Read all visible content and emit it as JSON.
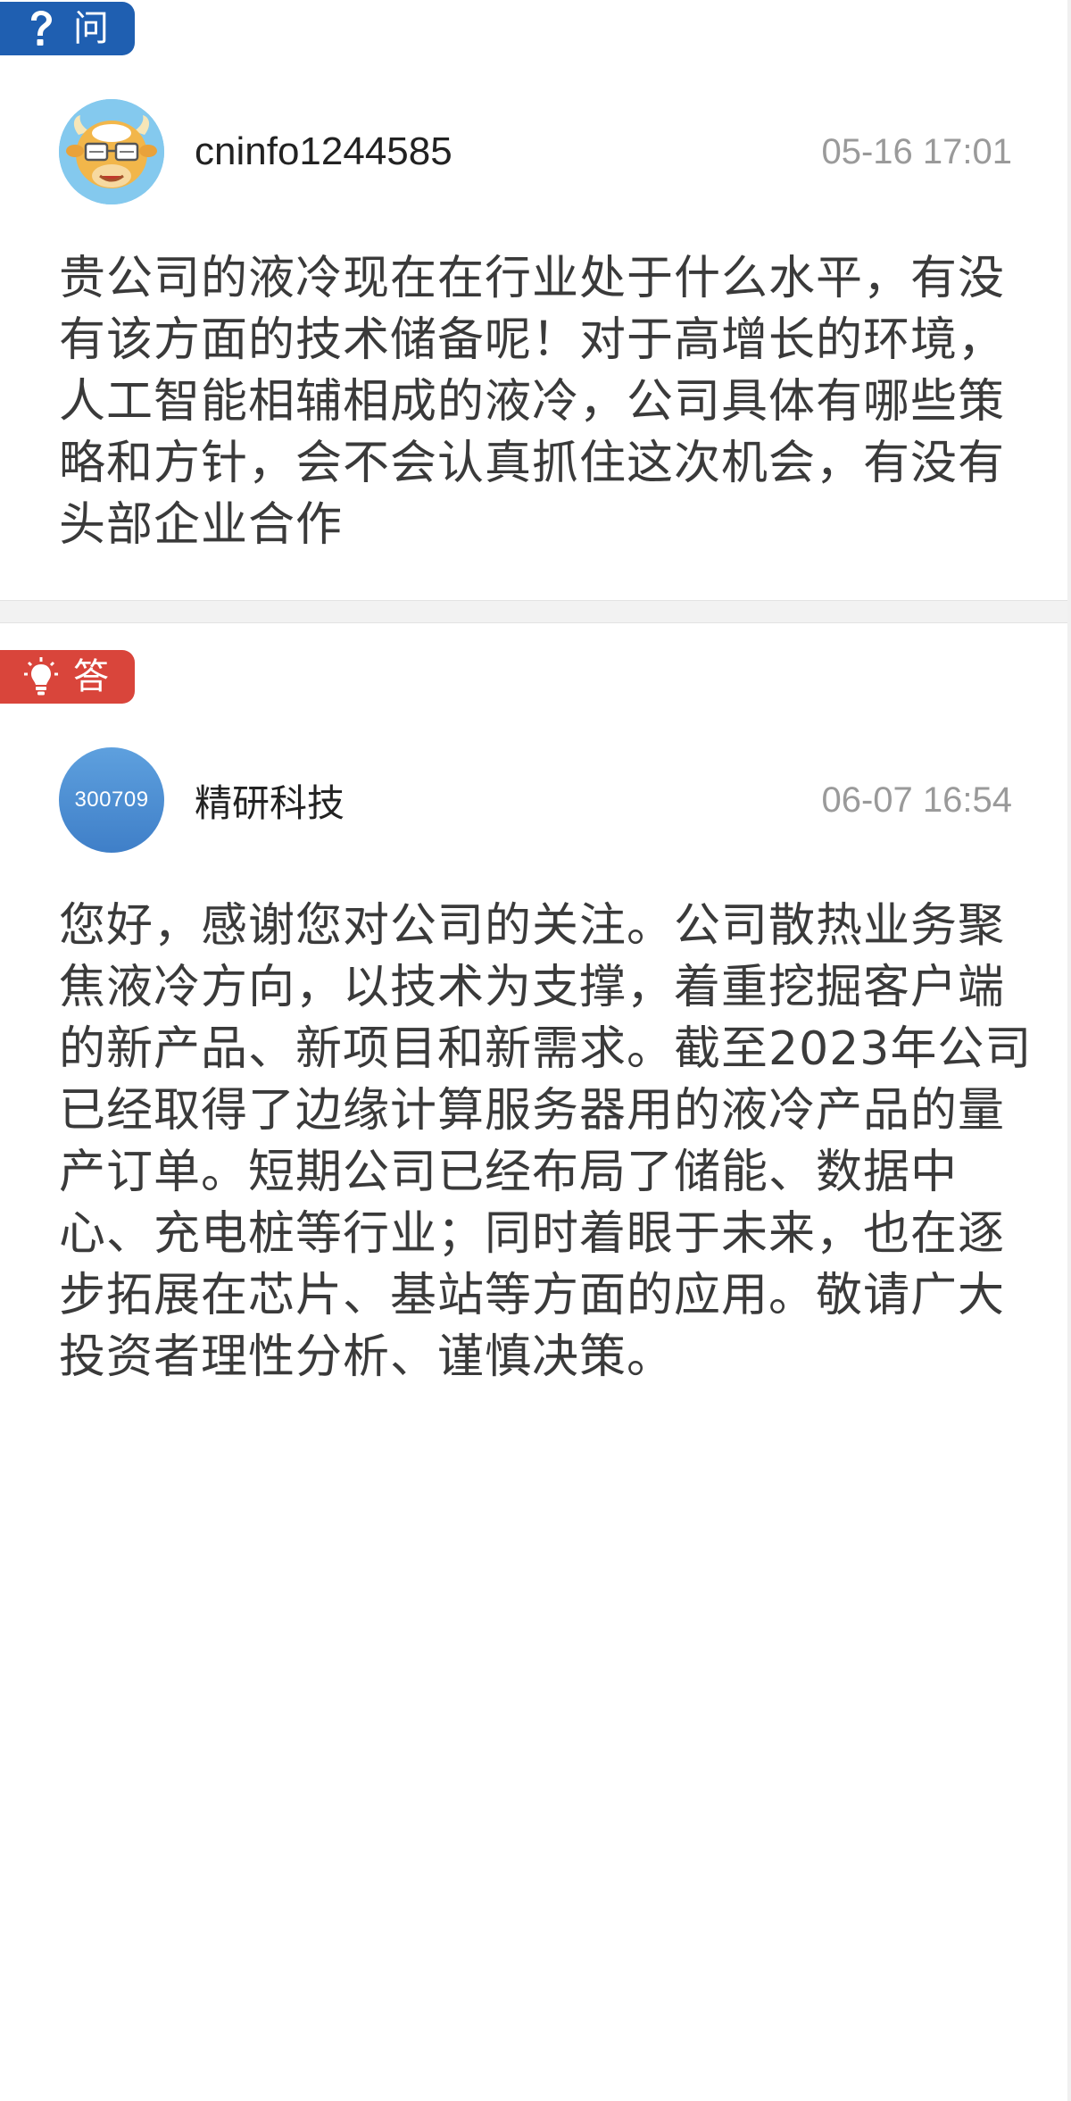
{
  "question": {
    "tag_label": "问",
    "tag_icon": "question-mark-icon",
    "tag_color": "#1f5fb1",
    "user": {
      "name": "cninfo1244585",
      "avatar": "cartoon-cow-avatar"
    },
    "time": "05-16 17:01",
    "lines": [
      "贵公司的液冷现在在行业处于什么水平，有没",
      "有该方面的技术储备呢！对于高增长的环境，",
      "人工智能相辅相成的液冷，公司具体有哪些策",
      "略和方针，会不会认真抓住这次机会，有没有",
      "头部企业合作"
    ]
  },
  "answer": {
    "tag_label": "答",
    "tag_icon": "lightbulb-icon",
    "tag_color": "#d9453b",
    "user": {
      "name": "精研科技",
      "avatar_code": "300709"
    },
    "time": "06-07 16:54",
    "lines": [
      "您好，感谢您对公司的关注。公司散热业务聚",
      "焦液冷方向，以技术为支撑，着重挖掘客户端",
      "的新产品、新项目和新需求。截至2023年公司",
      "已经取得了边缘计算服务器用的液冷产品的量",
      "产订单。短期公司已经布局了储能、数据中",
      "心、充电桩等行业；同时着眼于未来，也在逐",
      "步拓展在芯片、基站等方面的应用。敬请广大",
      "投资者理性分析、谨慎决策。"
    ]
  }
}
